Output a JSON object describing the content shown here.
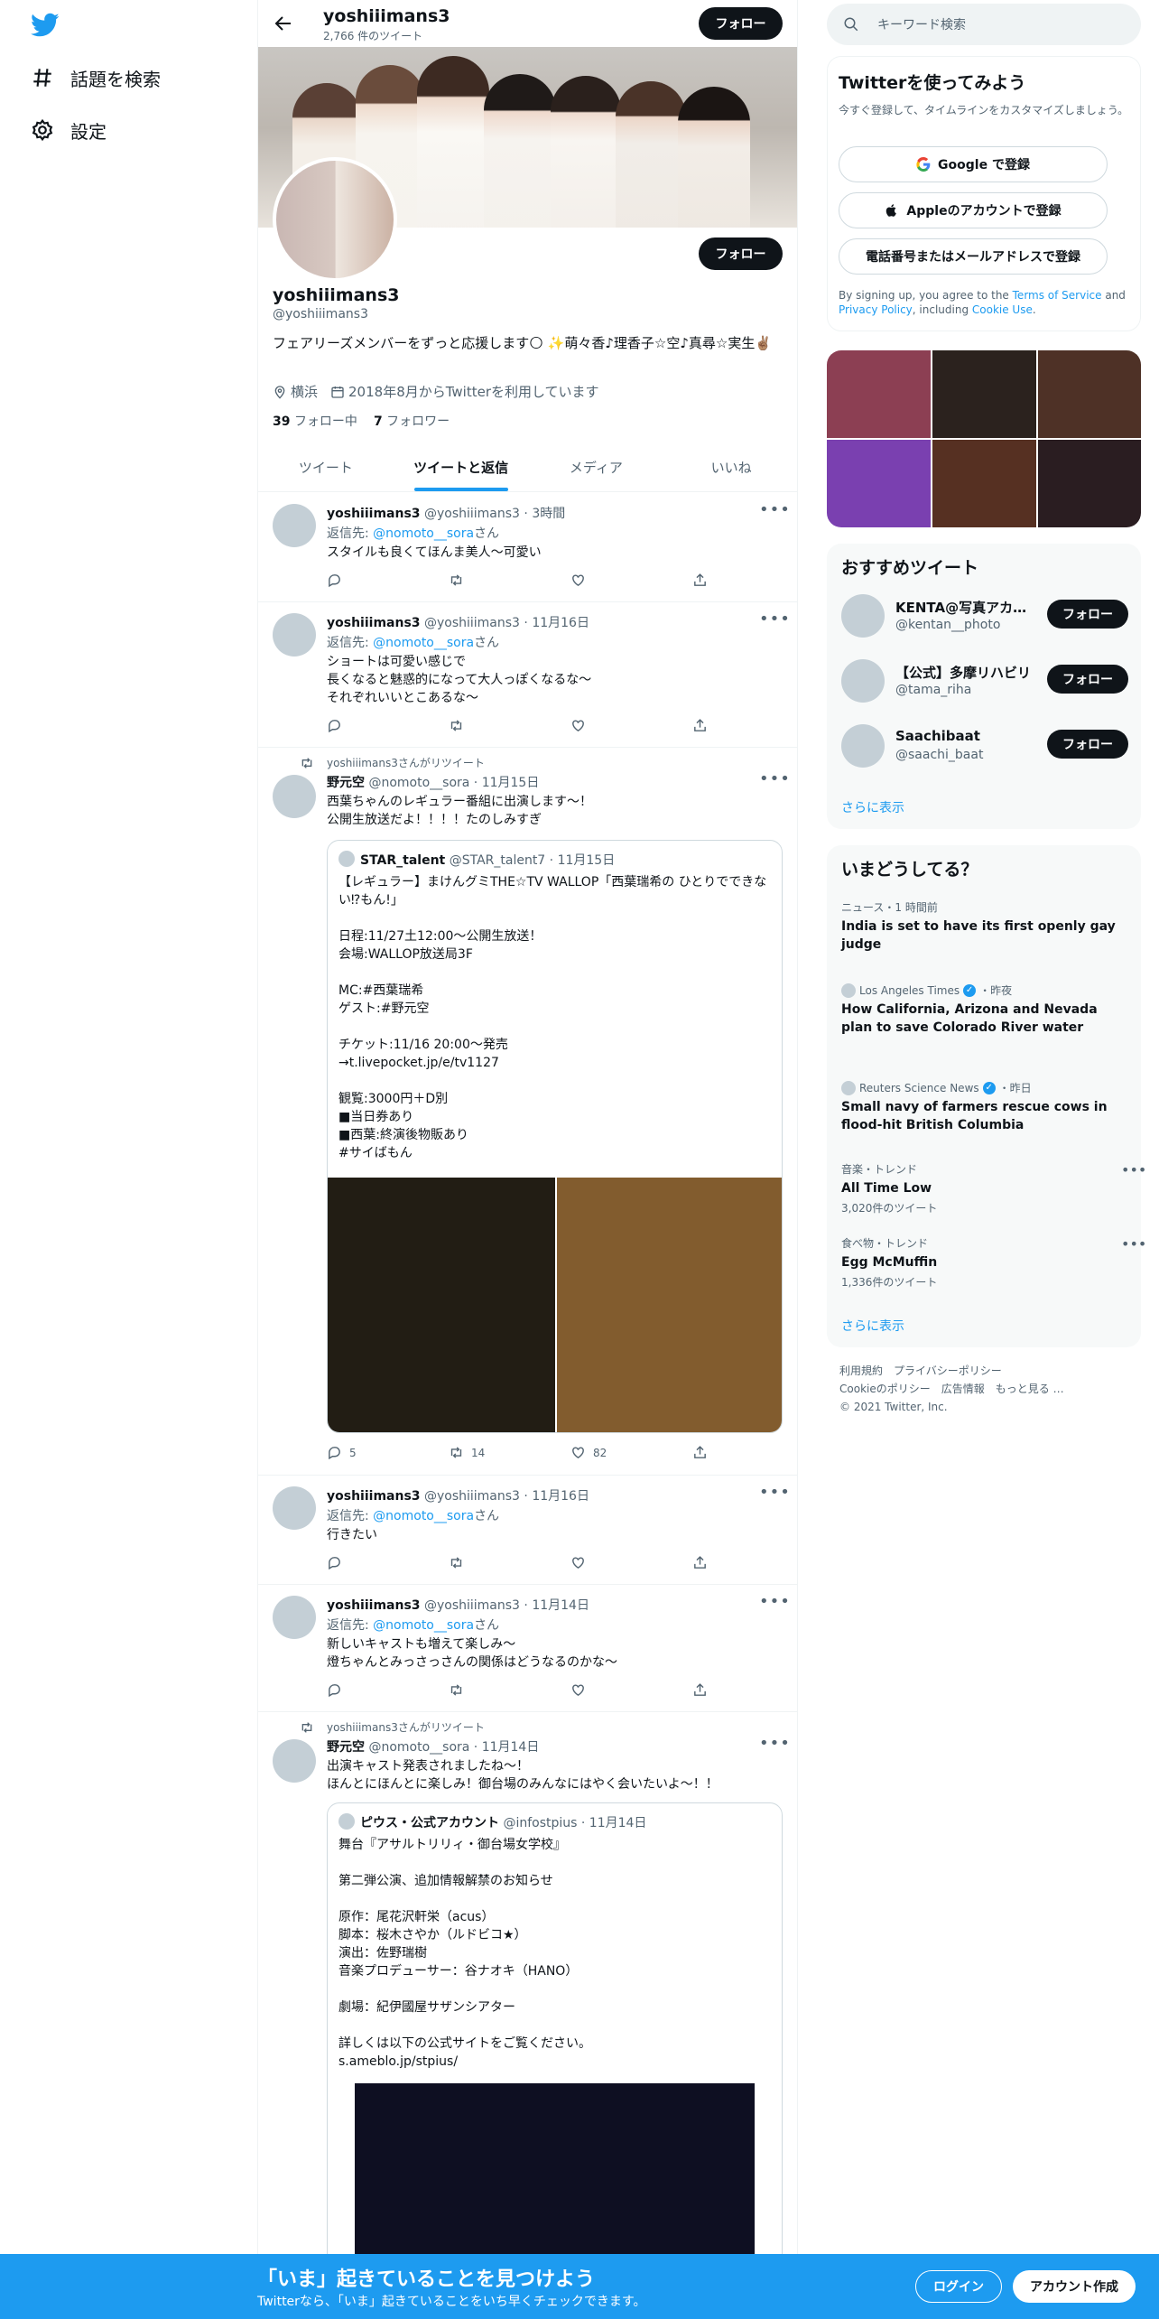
{
  "nav": {
    "explore_label": "話題を検索",
    "settings_label": "設定"
  },
  "topbar": {
    "name": "yoshiiimans3",
    "tweet_count": "2,766 件のツイート",
    "follow_label": "フォロー"
  },
  "profile": {
    "name": "yoshiiimans3",
    "handle": "@yoshiiimans3",
    "bio": "フェアリーズメンバーをずっと応援します🌕 ✨萌々香♪理香子☆空♪真尋☆実生✌🏽",
    "location": "横浜",
    "joined": "2018年8月からTwitterを利用しています",
    "following_count": "39",
    "following_label": "フォロー中",
    "followers_count": "7",
    "followers_label": "フォロワー",
    "follow_label": "フォロー"
  },
  "tabs": [
    "ツイート",
    "ツイートと返信",
    "メディア",
    "いいね"
  ],
  "tweets": [
    {
      "name": "yoshiiimans3",
      "handle": "@yoshiiimans3",
      "time": "3時間",
      "reply_prefix": "返信先: ",
      "reply_to": "@nomoto__sora",
      "reply_suffix": "さん",
      "text": "スタイルも良くてほんま美人〜可愛い"
    },
    {
      "name": "yoshiiimans3",
      "handle": "@yoshiiimans3",
      "time": "11月16日",
      "reply_prefix": "返信先: ",
      "reply_to": "@nomoto__sora",
      "reply_suffix": "さん",
      "text": "ショートは可愛い感じで\n長くなると魅惑的になって大人っぽくなるな〜\nそれぞれいいとこあるな〜"
    },
    {
      "retweet_label": "yoshiiimans3さんがリツイート",
      "name": "野元空",
      "handle": "@nomoto__sora",
      "time": "11月15日",
      "text": "西葉ちゃんのレギュラー番組に出演します〜！\n公開生放送だよ！！！！たのしみすぎ",
      "quote": {
        "name": "STAR_talent",
        "handle": "@STAR_talent7",
        "time": "11月15日",
        "text": "【レギュラー】まけんグミTHE☆TV WALLOP「西葉瑞希の ひとりでできない⁉もん!」\n\n日程:11/27土12:00〜公開生放送！\n会場:WALLOP放送局3F\n\nMC:#西葉瑞希\nゲスト:#野元空\n\nチケット:11/16 20:00〜発売\n→t.livepocket.jp/e/tv1127\n\n観覧:3000円＋D別\n■当日券あり\n■西葉:終演後物販あり\n#サイばもん"
      },
      "replies": "5",
      "retweets": "14",
      "likes": "82"
    },
    {
      "name": "yoshiiimans3",
      "handle": "@yoshiiimans3",
      "time": "11月16日",
      "reply_prefix": "返信先: ",
      "reply_to": "@nomoto__sora",
      "reply_suffix": "さん",
      "text": "行きたい"
    },
    {
      "name": "yoshiiimans3",
      "handle": "@yoshiiimans3",
      "time": "11月14日",
      "reply_prefix": "返信先: ",
      "reply_to": "@nomoto__sora",
      "reply_suffix": "さん",
      "text": "新しいキャストも増えて楽しみ〜\n燈ちゃんとみっさっさんの関係はどうなるのかな〜"
    },
    {
      "retweet_label": "yoshiiimans3さんがリツイート",
      "name": "野元空",
      "handle": "@nomoto__sora",
      "time": "11月14日",
      "text": "出演キャスト発表されましたね〜！\nほんとにほんとに楽しみ！御台場のみんなにはやく会いたいよ〜！！",
      "quote": {
        "name": "ピウス・公式アカウント",
        "handle": "@infostpius",
        "time": "11月14日",
        "text": "舞台『アサルトリリィ・御台場女学校』\n\n第二弾公演、追加情報解禁のお知らせ\n\n原作：尾花沢軒栄（acus）\n脚本：桜木さやか（ルドビコ★）\n演出：佐野瑞樹\n音楽プロデューサー：谷ナオキ（HANO）\n\n劇場：紀伊國屋サザンシアター\n\n詳しくは以下の公式サイトをご覧ください。\ns.ameblo.jp/stpius/"
      }
    }
  ],
  "search": {
    "placeholder": "キーワード検索"
  },
  "signup": {
    "title": "Twitterを使ってみよう",
    "subtitle": "今すぐ登録して、タイムラインをカスタマイズしましょう。",
    "google_label": "Google で登録",
    "apple_label": "Appleのアカウントで登録",
    "phone_label": "電話番号またはメールアドレスで登録",
    "fine_1": "By signing up, you agree to the ",
    "tos": "Terms of Service",
    "fine_2": " and ",
    "privacy": "Privacy Policy",
    "fine_3": ", including ",
    "cookie": "Cookie Use",
    "fine_4": "."
  },
  "recommended": {
    "title": "おすすめツイート",
    "accounts": [
      {
        "name": "KENTA@写真アカウント",
        "handle": "@kentan__photo"
      },
      {
        "name": "【公式】多摩リハビリ",
        "handle": "@tama_riha"
      },
      {
        "name": "Saachibaat",
        "handle": "@saachi_baat"
      }
    ],
    "follow_label": "フォロー",
    "show_more": "さらに表示"
  },
  "trends": {
    "title": "いまどうしてる？",
    "items": [
      {
        "meta": "ニュース・1 時間前",
        "title": "India is set to have its first openly gay judge"
      },
      {
        "source": "Los Angeles Times",
        "time": "・昨夜",
        "title": "How California, Arizona and Nevada plan to save Colorado River water"
      },
      {
        "source": "Reuters Science News",
        "time": "・昨日",
        "title": "Small navy of farmers rescue cows in flood-hit British Columbia"
      },
      {
        "meta": "音楽・トレンド",
        "title": "All Time Low",
        "count": "3,020件のツイート"
      },
      {
        "meta": "食べ物・トレンド",
        "title": "Egg McMuffin",
        "count": "1,336件のツイート"
      }
    ],
    "show_more": "さらに表示"
  },
  "footer": {
    "tos": "利用規約",
    "privacy": "プライバシーポリシー",
    "cookie": "Cookieのポリシー",
    "ads": "広告情報",
    "more": "もっと見る …",
    "copyright": "© 2021 Twitter, Inc."
  },
  "bottom_bar": {
    "title": "「いま」起きていることを見つけよう",
    "subtitle": "Twitterなら、「いま」起きていることをいち早くチェックできます。",
    "login": "ログイン",
    "signup": "アカウント作成"
  },
  "colors": {
    "accent": "#1d9bf0",
    "text": "#0f1419",
    "muted": "#536471"
  }
}
